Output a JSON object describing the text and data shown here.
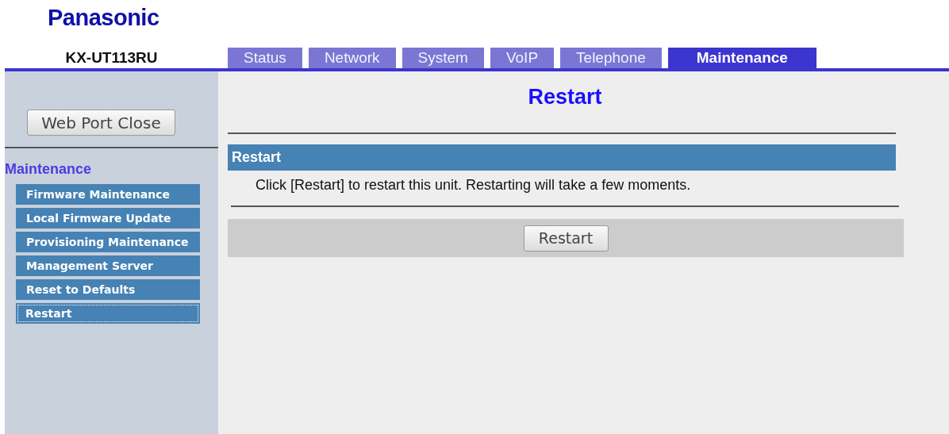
{
  "logo": "Panasonic",
  "model": "KX-UT113RU",
  "tabs": [
    {
      "label": "Status",
      "selected": false
    },
    {
      "label": "Network",
      "selected": false
    },
    {
      "label": "System",
      "selected": false
    },
    {
      "label": "VoIP",
      "selected": false
    },
    {
      "label": "Telephone",
      "selected": false
    },
    {
      "label": "Maintenance",
      "selected": true
    }
  ],
  "sidebar": {
    "button": "Web Port Close",
    "heading": "Maintenance",
    "items": [
      {
        "label": "Firmware Maintenance",
        "selected": false
      },
      {
        "label": "Local Firmware Update",
        "selected": false
      },
      {
        "label": "Provisioning Maintenance",
        "selected": false
      },
      {
        "label": "Management Server",
        "selected": false
      },
      {
        "label": "Reset to Defaults",
        "selected": false
      },
      {
        "label": "Restart",
        "selected": true
      }
    ]
  },
  "main": {
    "title": "Restart",
    "section": "Restart",
    "message": "Click [Restart] to restart this unit. Restarting will take a few moments.",
    "button": "Restart"
  }
}
